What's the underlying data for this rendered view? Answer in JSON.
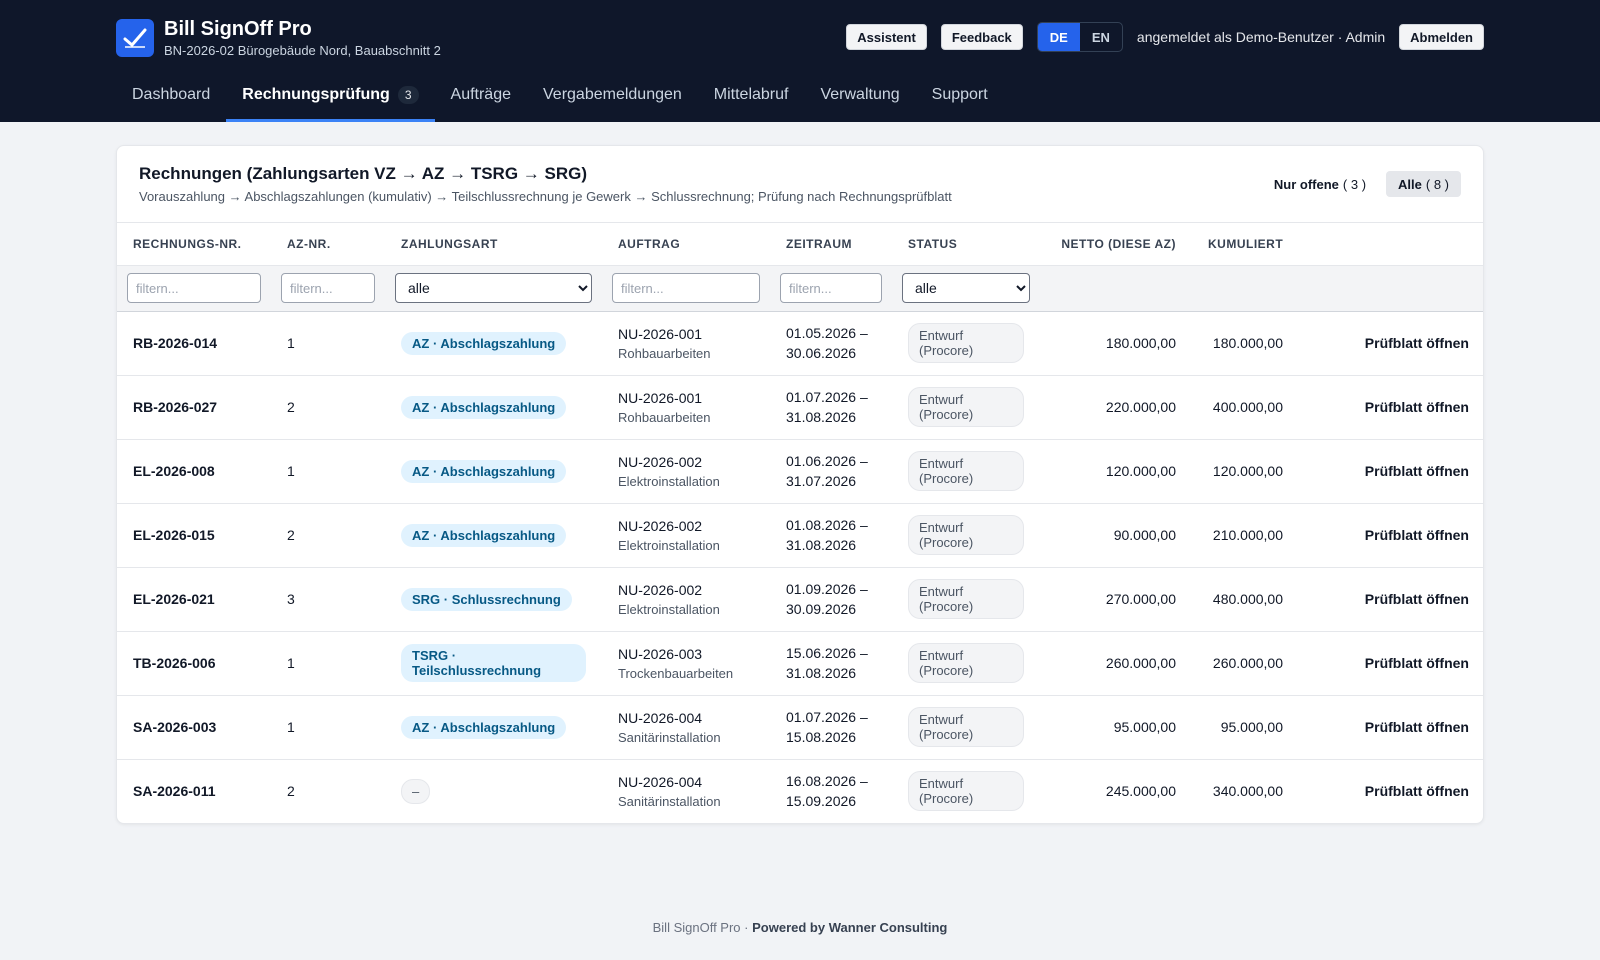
{
  "header": {
    "title": "Bill SignOff Pro",
    "subtitle": "BN-2026-02 Bürogebäude Nord, Bauabschnitt 2",
    "logo_icon": "check-icon",
    "buttons": {
      "assistant": "Assistent",
      "feedback": "Feedback",
      "logout": "Abmelden"
    },
    "lang": {
      "de": "DE",
      "en": "EN",
      "active": "DE"
    },
    "user_text": "angemeldet als Demo-Benutzer · Admin"
  },
  "nav": {
    "items": [
      {
        "label": "Dashboard"
      },
      {
        "label": "Rechnungsprüfung",
        "badge": "3",
        "active": true
      },
      {
        "label": "Aufträge"
      },
      {
        "label": "Vergabemeldungen"
      },
      {
        "label": "Mittelabruf"
      },
      {
        "label": "Verwaltung"
      },
      {
        "label": "Support"
      }
    ]
  },
  "card": {
    "title": "Rechnungen (Zahlungsarten VZ → AZ → TSRG → SRG)",
    "subtitle": "Vorauszahlung → Abschlagszahlungen (kumulativ) → Teilschlussrechnung je Gewerk → Schlussrechnung; Prüfung nach Rechnungsprüfblatt",
    "filter_open": {
      "label": "Nur offene",
      "count": "( 3 )"
    },
    "filter_all": {
      "label": "Alle",
      "count": "( 8 )"
    }
  },
  "table": {
    "columns": [
      "Rechnungs-Nr.",
      "AZ-Nr.",
      "Zahlungsart",
      "Auftrag",
      "Zeitraum",
      "Status",
      "Netto (diese AZ)",
      "Kumuliert"
    ],
    "filter_placeholder": "filtern...",
    "select_default": "alle",
    "action_label": "Prüfblatt öffnen",
    "rows": [
      {
        "nr": "RB-2026-014",
        "az": "1",
        "art": "AZ · Abschlagszahlung",
        "auftrag": "NU-2026-001",
        "gewerk": "Rohbauarbeiten",
        "von": "01.05.2026 –",
        "bis": "30.06.2026",
        "status": "Entwurf (Procore)",
        "netto": "180.000,00",
        "kum": "180.000,00"
      },
      {
        "nr": "RB-2026-027",
        "az": "2",
        "art": "AZ · Abschlagszahlung",
        "auftrag": "NU-2026-001",
        "gewerk": "Rohbauarbeiten",
        "von": "01.07.2026 –",
        "bis": "31.08.2026",
        "status": "Entwurf (Procore)",
        "netto": "220.000,00",
        "kum": "400.000,00"
      },
      {
        "nr": "EL-2026-008",
        "az": "1",
        "art": "AZ · Abschlagszahlung",
        "auftrag": "NU-2026-002",
        "gewerk": "Elektroinstallation",
        "von": "01.06.2026 –",
        "bis": "31.07.2026",
        "status": "Entwurf (Procore)",
        "netto": "120.000,00",
        "kum": "120.000,00"
      },
      {
        "nr": "EL-2026-015",
        "az": "2",
        "art": "AZ · Abschlagszahlung",
        "auftrag": "NU-2026-002",
        "gewerk": "Elektroinstallation",
        "von": "01.08.2026 –",
        "bis": "31.08.2026",
        "status": "Entwurf (Procore)",
        "netto": "90.000,00",
        "kum": "210.000,00"
      },
      {
        "nr": "EL-2026-021",
        "az": "3",
        "art": "SRG · Schlussrechnung",
        "auftrag": "NU-2026-002",
        "gewerk": "Elektroinstallation",
        "von": "01.09.2026 –",
        "bis": "30.09.2026",
        "status": "Entwurf (Procore)",
        "netto": "270.000,00",
        "kum": "480.000,00"
      },
      {
        "nr": "TB-2026-006",
        "az": "1",
        "art": "TSRG · Teilschlussrechnung",
        "auftrag": "NU-2026-003",
        "gewerk": "Trockenbauarbeiten",
        "von": "15.06.2026 –",
        "bis": "31.08.2026",
        "status": "Entwurf (Procore)",
        "netto": "260.000,00",
        "kum": "260.000,00"
      },
      {
        "nr": "SA-2026-003",
        "az": "1",
        "art": "AZ · Abschlagszahlung",
        "auftrag": "NU-2026-004",
        "gewerk": "Sanitärinstallation",
        "von": "01.07.2026 –",
        "bis": "15.08.2026",
        "status": "Entwurf (Procore)",
        "netto": "95.000,00",
        "kum": "95.000,00"
      },
      {
        "nr": "SA-2026-011",
        "az": "2",
        "art": "–",
        "auftrag": "NU-2026-004",
        "gewerk": "Sanitärinstallation",
        "von": "16.08.2026 –",
        "bis": "15.09.2026",
        "status": "Entwurf (Procore)",
        "netto": "245.000,00",
        "kum": "340.000,00"
      }
    ]
  },
  "footer": {
    "prefix": "Bill SignOff Pro ·",
    "strong": "Powered by Wanner Consulting"
  }
}
